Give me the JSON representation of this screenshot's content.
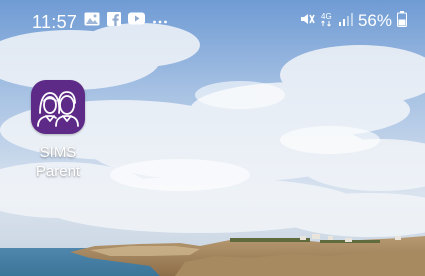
{
  "status_bar": {
    "time": "11:57",
    "notification_icons": [
      "gallery-icon",
      "facebook-icon",
      "youtube-icon",
      "more-notifications-icon"
    ],
    "network_label": "4G",
    "battery_percent": "56%"
  },
  "home_screen": {
    "apps": [
      {
        "icon": "sims-parent-icon",
        "label_line1": "SIMS",
        "label_line2": "Parent",
        "icon_color": "#5e2a87"
      }
    ]
  }
}
